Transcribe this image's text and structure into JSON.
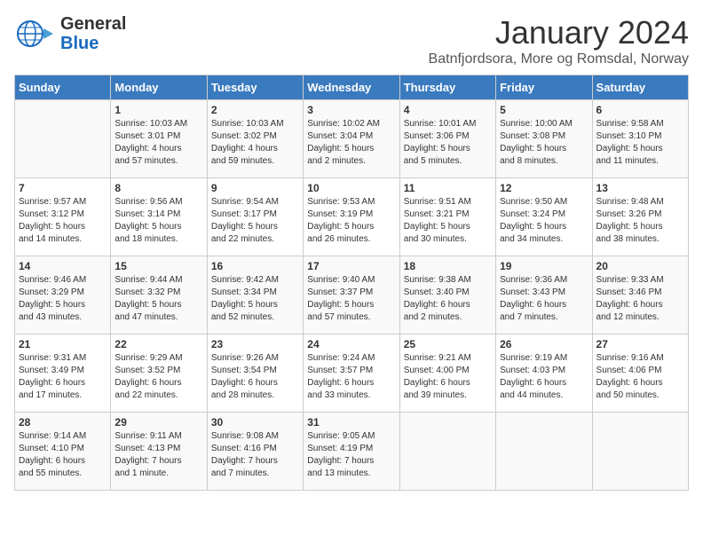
{
  "logo": {
    "line1": "General",
    "line2": "Blue"
  },
  "title": "January 2024",
  "subtitle": "Batnfjordsora, More og Romsdal, Norway",
  "days_of_week": [
    "Sunday",
    "Monday",
    "Tuesday",
    "Wednesday",
    "Thursday",
    "Friday",
    "Saturday"
  ],
  "weeks": [
    [
      {
        "day": "",
        "info": ""
      },
      {
        "day": "1",
        "info": "Sunrise: 10:03 AM\nSunset: 3:01 PM\nDaylight: 4 hours\nand 57 minutes."
      },
      {
        "day": "2",
        "info": "Sunrise: 10:03 AM\nSunset: 3:02 PM\nDaylight: 4 hours\nand 59 minutes."
      },
      {
        "day": "3",
        "info": "Sunrise: 10:02 AM\nSunset: 3:04 PM\nDaylight: 5 hours\nand 2 minutes."
      },
      {
        "day": "4",
        "info": "Sunrise: 10:01 AM\nSunset: 3:06 PM\nDaylight: 5 hours\nand 5 minutes."
      },
      {
        "day": "5",
        "info": "Sunrise: 10:00 AM\nSunset: 3:08 PM\nDaylight: 5 hours\nand 8 minutes."
      },
      {
        "day": "6",
        "info": "Sunrise: 9:58 AM\nSunset: 3:10 PM\nDaylight: 5 hours\nand 11 minutes."
      }
    ],
    [
      {
        "day": "7",
        "info": "Sunrise: 9:57 AM\nSunset: 3:12 PM\nDaylight: 5 hours\nand 14 minutes."
      },
      {
        "day": "8",
        "info": "Sunrise: 9:56 AM\nSunset: 3:14 PM\nDaylight: 5 hours\nand 18 minutes."
      },
      {
        "day": "9",
        "info": "Sunrise: 9:54 AM\nSunset: 3:17 PM\nDaylight: 5 hours\nand 22 minutes."
      },
      {
        "day": "10",
        "info": "Sunrise: 9:53 AM\nSunset: 3:19 PM\nDaylight: 5 hours\nand 26 minutes."
      },
      {
        "day": "11",
        "info": "Sunrise: 9:51 AM\nSunset: 3:21 PM\nDaylight: 5 hours\nand 30 minutes."
      },
      {
        "day": "12",
        "info": "Sunrise: 9:50 AM\nSunset: 3:24 PM\nDaylight: 5 hours\nand 34 minutes."
      },
      {
        "day": "13",
        "info": "Sunrise: 9:48 AM\nSunset: 3:26 PM\nDaylight: 5 hours\nand 38 minutes."
      }
    ],
    [
      {
        "day": "14",
        "info": "Sunrise: 9:46 AM\nSunset: 3:29 PM\nDaylight: 5 hours\nand 43 minutes."
      },
      {
        "day": "15",
        "info": "Sunrise: 9:44 AM\nSunset: 3:32 PM\nDaylight: 5 hours\nand 47 minutes."
      },
      {
        "day": "16",
        "info": "Sunrise: 9:42 AM\nSunset: 3:34 PM\nDaylight: 5 hours\nand 52 minutes."
      },
      {
        "day": "17",
        "info": "Sunrise: 9:40 AM\nSunset: 3:37 PM\nDaylight: 5 hours\nand 57 minutes."
      },
      {
        "day": "18",
        "info": "Sunrise: 9:38 AM\nSunset: 3:40 PM\nDaylight: 6 hours\nand 2 minutes."
      },
      {
        "day": "19",
        "info": "Sunrise: 9:36 AM\nSunset: 3:43 PM\nDaylight: 6 hours\nand 7 minutes."
      },
      {
        "day": "20",
        "info": "Sunrise: 9:33 AM\nSunset: 3:46 PM\nDaylight: 6 hours\nand 12 minutes."
      }
    ],
    [
      {
        "day": "21",
        "info": "Sunrise: 9:31 AM\nSunset: 3:49 PM\nDaylight: 6 hours\nand 17 minutes."
      },
      {
        "day": "22",
        "info": "Sunrise: 9:29 AM\nSunset: 3:52 PM\nDaylight: 6 hours\nand 22 minutes."
      },
      {
        "day": "23",
        "info": "Sunrise: 9:26 AM\nSunset: 3:54 PM\nDaylight: 6 hours\nand 28 minutes."
      },
      {
        "day": "24",
        "info": "Sunrise: 9:24 AM\nSunset: 3:57 PM\nDaylight: 6 hours\nand 33 minutes."
      },
      {
        "day": "25",
        "info": "Sunrise: 9:21 AM\nSunset: 4:00 PM\nDaylight: 6 hours\nand 39 minutes."
      },
      {
        "day": "26",
        "info": "Sunrise: 9:19 AM\nSunset: 4:03 PM\nDaylight: 6 hours\nand 44 minutes."
      },
      {
        "day": "27",
        "info": "Sunrise: 9:16 AM\nSunset: 4:06 PM\nDaylight: 6 hours\nand 50 minutes."
      }
    ],
    [
      {
        "day": "28",
        "info": "Sunrise: 9:14 AM\nSunset: 4:10 PM\nDaylight: 6 hours\nand 55 minutes."
      },
      {
        "day": "29",
        "info": "Sunrise: 9:11 AM\nSunset: 4:13 PM\nDaylight: 7 hours\nand 1 minute."
      },
      {
        "day": "30",
        "info": "Sunrise: 9:08 AM\nSunset: 4:16 PM\nDaylight: 7 hours\nand 7 minutes."
      },
      {
        "day": "31",
        "info": "Sunrise: 9:05 AM\nSunset: 4:19 PM\nDaylight: 7 hours\nand 13 minutes."
      },
      {
        "day": "",
        "info": ""
      },
      {
        "day": "",
        "info": ""
      },
      {
        "day": "",
        "info": ""
      }
    ]
  ]
}
